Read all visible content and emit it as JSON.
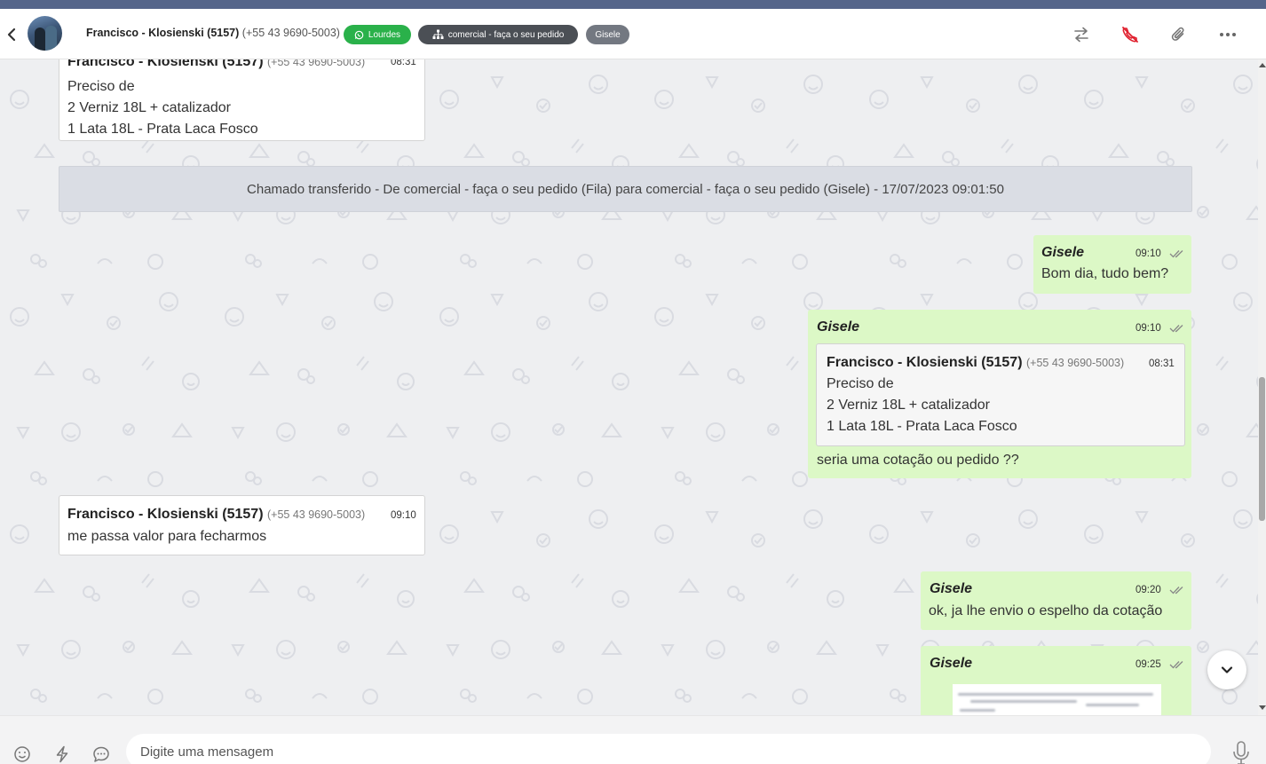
{
  "header": {
    "contact_name": "Francisco - Klosienski (5157)",
    "contact_phone": "(+55 43 9690-5003)",
    "tags": [
      {
        "label": "Lourdes",
        "color": "#2ab14a",
        "icon": "whatsapp-icon"
      },
      {
        "label": "comercial - faça o seu pedido",
        "color": "#4b4f55",
        "icon": "org-chart-icon"
      },
      {
        "label": "Gisele",
        "color": "#737881"
      }
    ],
    "actions": [
      "transfer-icon",
      "end-call-icon",
      "paperclip-icon",
      "more-icon"
    ]
  },
  "messages": {
    "m1": {
      "sender": "Francisco - Klosienski (5157)",
      "phone": "(+55 43 9690-5003)",
      "time": "08:31",
      "lines": [
        "Preciso de",
        "2 Verniz 18L + catalizador",
        "1 Lata 18L - Prata Laca Fosco"
      ]
    },
    "system": {
      "text": "Chamado transferido - De comercial - faça o seu pedido (Fila) para comercial - faça o seu pedido (Gisele) - 17/07/2023 09:01:50"
    },
    "m2": {
      "agent": "Gisele",
      "time": "09:10",
      "text": "Bom dia, tudo bem?"
    },
    "m3": {
      "agent": "Gisele",
      "time": "09:10",
      "quote": {
        "sender": "Francisco - Klosienski (5157)",
        "phone": "(+55 43 9690-5003)",
        "time": "08:31",
        "lines": [
          "Preciso de",
          "2 Verniz 18L + catalizador",
          "1 Lata 18L - Prata Laca Fosco"
        ]
      },
      "text": "seria uma cotação ou pedido ??"
    },
    "m4": {
      "sender": "Francisco - Klosienski (5157)",
      "phone": "(+55 43 9690-5003)",
      "time": "09:10",
      "text": "me passa valor para fecharmos"
    },
    "m5": {
      "agent": "Gisele",
      "time": "09:20",
      "text": "ok, ja lhe envio o espelho da cotação"
    },
    "m6": {
      "agent": "Gisele",
      "time": "09:25"
    }
  },
  "composer": {
    "placeholder": "Digite uma mensagem"
  },
  "colors": {
    "topbar": "#55658a",
    "outgoing_bubble": "#dcf8c6",
    "chat_background": "#eeeff1",
    "tag_green": "#2ab14a"
  }
}
